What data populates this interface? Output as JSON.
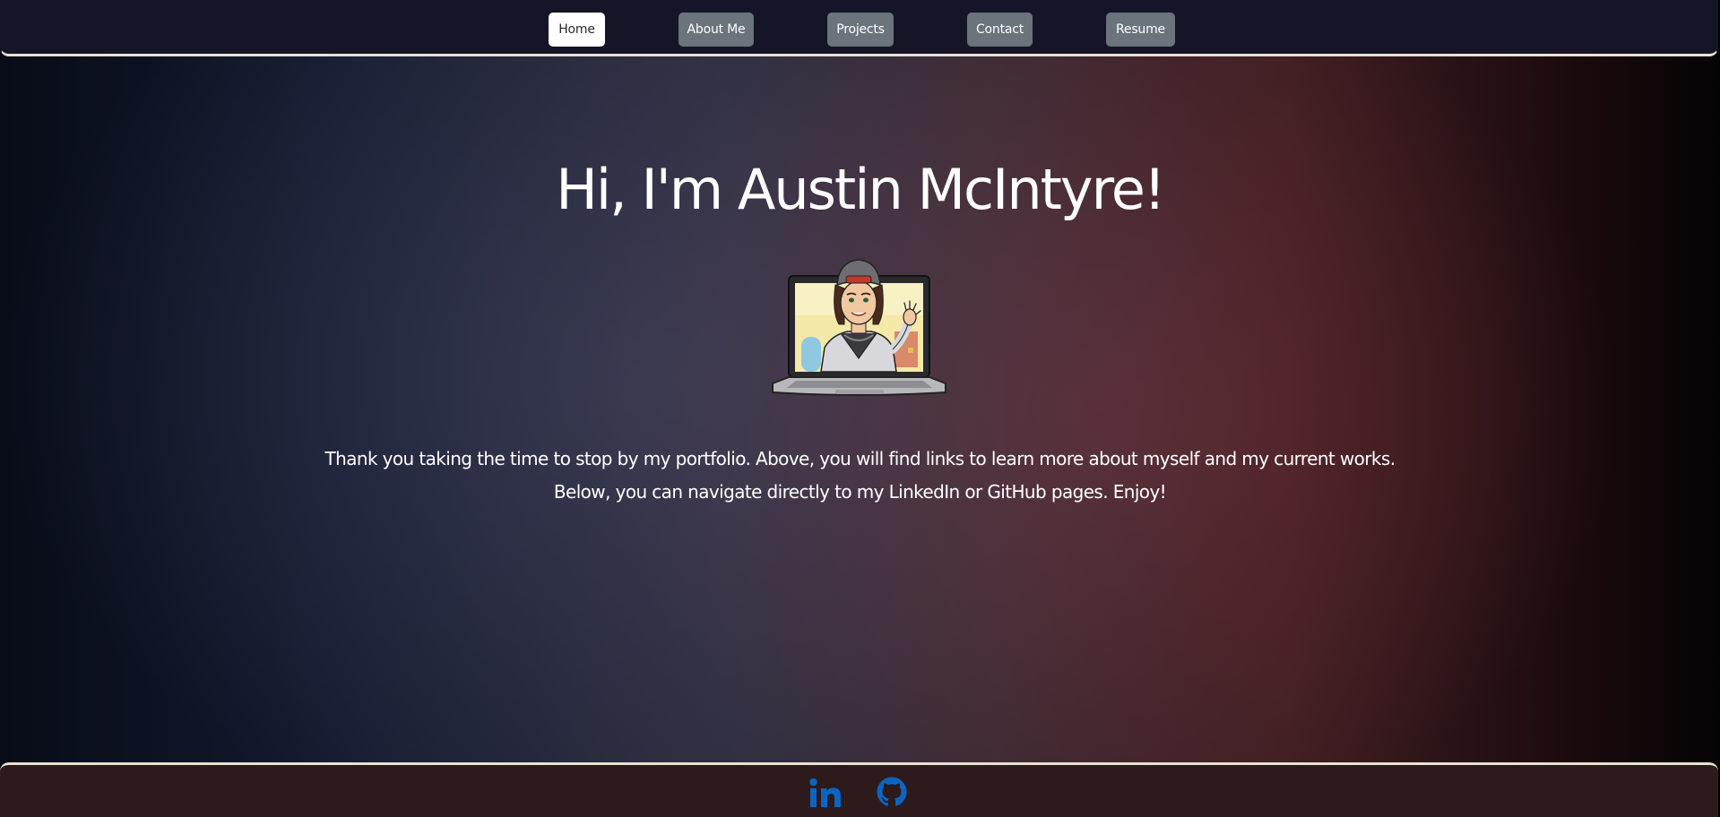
{
  "nav": {
    "items": [
      {
        "label": "Home",
        "active": true
      },
      {
        "label": "About Me",
        "active": false
      },
      {
        "label": "Projects",
        "active": false
      },
      {
        "label": "Contact",
        "active": false
      },
      {
        "label": "Resume",
        "active": false
      }
    ]
  },
  "hero": {
    "title": "Hi, I'm Austin McIntyre!",
    "avatar_icon": "bitmoji-laptop-wave",
    "intro": "Thank you taking the time to stop by my portfolio. Above, you will find links to learn more about myself and my current works. Below, you can navigate directly to my LinkedIn or GitHub pages. Enjoy!"
  },
  "footer": {
    "links": [
      {
        "icon": "linkedin-icon"
      },
      {
        "icon": "github-icon"
      }
    ]
  },
  "colors": {
    "nav_active_bg": "#ffffff",
    "nav_inactive_bg": "#6b737b",
    "header_bg": "#161527",
    "footer_bg": "#2c1a1c",
    "border_accent": "#e8e2d0",
    "social_icon": "#0a66c2"
  }
}
